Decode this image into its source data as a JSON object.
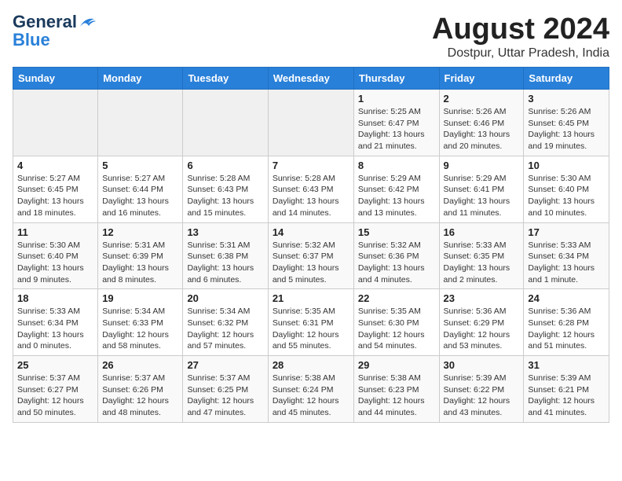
{
  "logo": {
    "line1": "General",
    "line2": "Blue"
  },
  "title": "August 2024",
  "location": "Dostpur, Uttar Pradesh, India",
  "weekdays": [
    "Sunday",
    "Monday",
    "Tuesday",
    "Wednesday",
    "Thursday",
    "Friday",
    "Saturday"
  ],
  "weeks": [
    [
      {
        "day": "",
        "info": ""
      },
      {
        "day": "",
        "info": ""
      },
      {
        "day": "",
        "info": ""
      },
      {
        "day": "",
        "info": ""
      },
      {
        "day": "1",
        "info": "Sunrise: 5:25 AM\nSunset: 6:47 PM\nDaylight: 13 hours\nand 21 minutes."
      },
      {
        "day": "2",
        "info": "Sunrise: 5:26 AM\nSunset: 6:46 PM\nDaylight: 13 hours\nand 20 minutes."
      },
      {
        "day": "3",
        "info": "Sunrise: 5:26 AM\nSunset: 6:45 PM\nDaylight: 13 hours\nand 19 minutes."
      }
    ],
    [
      {
        "day": "4",
        "info": "Sunrise: 5:27 AM\nSunset: 6:45 PM\nDaylight: 13 hours\nand 18 minutes."
      },
      {
        "day": "5",
        "info": "Sunrise: 5:27 AM\nSunset: 6:44 PM\nDaylight: 13 hours\nand 16 minutes."
      },
      {
        "day": "6",
        "info": "Sunrise: 5:28 AM\nSunset: 6:43 PM\nDaylight: 13 hours\nand 15 minutes."
      },
      {
        "day": "7",
        "info": "Sunrise: 5:28 AM\nSunset: 6:43 PM\nDaylight: 13 hours\nand 14 minutes."
      },
      {
        "day": "8",
        "info": "Sunrise: 5:29 AM\nSunset: 6:42 PM\nDaylight: 13 hours\nand 13 minutes."
      },
      {
        "day": "9",
        "info": "Sunrise: 5:29 AM\nSunset: 6:41 PM\nDaylight: 13 hours\nand 11 minutes."
      },
      {
        "day": "10",
        "info": "Sunrise: 5:30 AM\nSunset: 6:40 PM\nDaylight: 13 hours\nand 10 minutes."
      }
    ],
    [
      {
        "day": "11",
        "info": "Sunrise: 5:30 AM\nSunset: 6:40 PM\nDaylight: 13 hours\nand 9 minutes."
      },
      {
        "day": "12",
        "info": "Sunrise: 5:31 AM\nSunset: 6:39 PM\nDaylight: 13 hours\nand 8 minutes."
      },
      {
        "day": "13",
        "info": "Sunrise: 5:31 AM\nSunset: 6:38 PM\nDaylight: 13 hours\nand 6 minutes."
      },
      {
        "day": "14",
        "info": "Sunrise: 5:32 AM\nSunset: 6:37 PM\nDaylight: 13 hours\nand 5 minutes."
      },
      {
        "day": "15",
        "info": "Sunrise: 5:32 AM\nSunset: 6:36 PM\nDaylight: 13 hours\nand 4 minutes."
      },
      {
        "day": "16",
        "info": "Sunrise: 5:33 AM\nSunset: 6:35 PM\nDaylight: 13 hours\nand 2 minutes."
      },
      {
        "day": "17",
        "info": "Sunrise: 5:33 AM\nSunset: 6:34 PM\nDaylight: 13 hours\nand 1 minute."
      }
    ],
    [
      {
        "day": "18",
        "info": "Sunrise: 5:33 AM\nSunset: 6:34 PM\nDaylight: 13 hours\nand 0 minutes."
      },
      {
        "day": "19",
        "info": "Sunrise: 5:34 AM\nSunset: 6:33 PM\nDaylight: 12 hours\nand 58 minutes."
      },
      {
        "day": "20",
        "info": "Sunrise: 5:34 AM\nSunset: 6:32 PM\nDaylight: 12 hours\nand 57 minutes."
      },
      {
        "day": "21",
        "info": "Sunrise: 5:35 AM\nSunset: 6:31 PM\nDaylight: 12 hours\nand 55 minutes."
      },
      {
        "day": "22",
        "info": "Sunrise: 5:35 AM\nSunset: 6:30 PM\nDaylight: 12 hours\nand 54 minutes."
      },
      {
        "day": "23",
        "info": "Sunrise: 5:36 AM\nSunset: 6:29 PM\nDaylight: 12 hours\nand 53 minutes."
      },
      {
        "day": "24",
        "info": "Sunrise: 5:36 AM\nSunset: 6:28 PM\nDaylight: 12 hours\nand 51 minutes."
      }
    ],
    [
      {
        "day": "25",
        "info": "Sunrise: 5:37 AM\nSunset: 6:27 PM\nDaylight: 12 hours\nand 50 minutes."
      },
      {
        "day": "26",
        "info": "Sunrise: 5:37 AM\nSunset: 6:26 PM\nDaylight: 12 hours\nand 48 minutes."
      },
      {
        "day": "27",
        "info": "Sunrise: 5:37 AM\nSunset: 6:25 PM\nDaylight: 12 hours\nand 47 minutes."
      },
      {
        "day": "28",
        "info": "Sunrise: 5:38 AM\nSunset: 6:24 PM\nDaylight: 12 hours\nand 45 minutes."
      },
      {
        "day": "29",
        "info": "Sunrise: 5:38 AM\nSunset: 6:23 PM\nDaylight: 12 hours\nand 44 minutes."
      },
      {
        "day": "30",
        "info": "Sunrise: 5:39 AM\nSunset: 6:22 PM\nDaylight: 12 hours\nand 43 minutes."
      },
      {
        "day": "31",
        "info": "Sunrise: 5:39 AM\nSunset: 6:21 PM\nDaylight: 12 hours\nand 41 minutes."
      }
    ]
  ]
}
